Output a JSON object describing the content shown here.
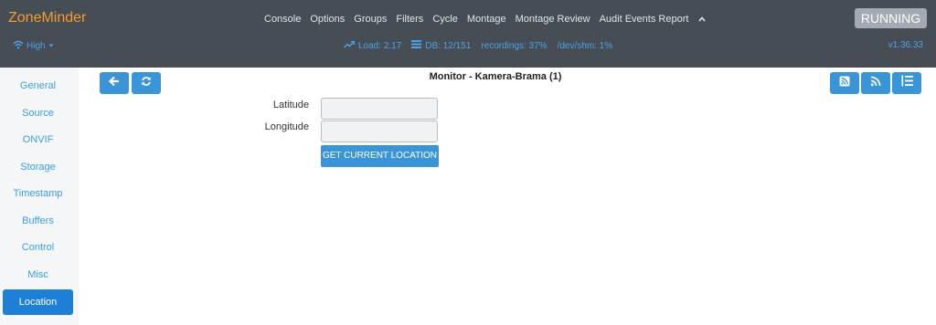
{
  "header": {
    "brand": "ZoneMinder",
    "nav": [
      "Console",
      "Options",
      "Groups",
      "Filters",
      "Cycle",
      "Montage",
      "Montage Review",
      "Audit Events Report"
    ],
    "status": "RUNNING",
    "bandwidth": "High",
    "load": "Load: 2.17",
    "db": "DB: 12/151",
    "recordings": "recordings: 37%",
    "shm": "/dev/shm: 1%",
    "version": "v1.36.33"
  },
  "sidebar": {
    "items": [
      "General",
      "Source",
      "ONVIF",
      "Storage",
      "Timestamp",
      "Buffers",
      "Control",
      "Misc",
      "Location"
    ],
    "active": "Location"
  },
  "main": {
    "title": "Monitor - Kamera-Brama (1)",
    "latitude_label": "Latitude",
    "latitude_value": "",
    "longitude_label": "Longitude",
    "longitude_value": "",
    "get_location_button": "GET CURRENT LOCATION"
  },
  "colors": {
    "topbar": "#464d55",
    "brand": "#f39c32",
    "accent": "#3a95d8",
    "active_tab": "#1e7fd6"
  },
  "icons": {
    "back": "arrow-left-icon",
    "refresh": "refresh-icon",
    "rss1": "rss-square-icon",
    "rss2": "rss-icon",
    "list": "list-ordered-icon"
  }
}
